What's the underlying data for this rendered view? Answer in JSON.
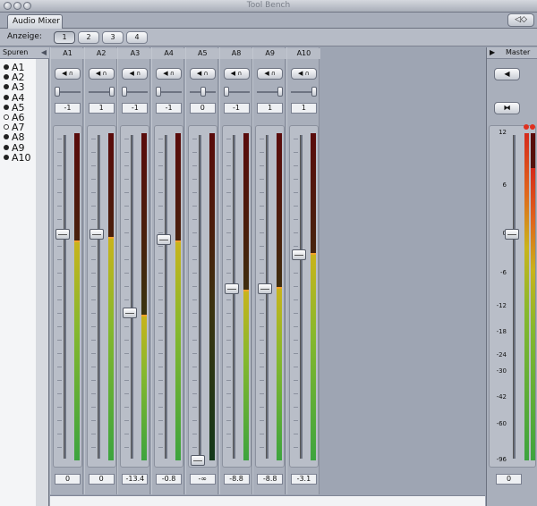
{
  "window": {
    "title": "Tool Bench"
  },
  "tab": {
    "label": "Audio Mixer",
    "icon": "speaker-icon",
    "icon_glyph": "◁◇"
  },
  "toolbar": {
    "label": "Anzeige:",
    "views": [
      "1",
      "2",
      "3",
      "4"
    ],
    "active_view": "1"
  },
  "tracks": {
    "header": "Spuren",
    "items": [
      {
        "label": "A1",
        "enabled": true
      },
      {
        "label": "A2",
        "enabled": true
      },
      {
        "label": "A3",
        "enabled": true
      },
      {
        "label": "A4",
        "enabled": true
      },
      {
        "label": "A5",
        "enabled": true
      },
      {
        "label": "A6",
        "enabled": false
      },
      {
        "label": "A7",
        "enabled": false
      },
      {
        "label": "A8",
        "enabled": true
      },
      {
        "label": "A9",
        "enabled": true
      },
      {
        "label": "A10",
        "enabled": true
      }
    ]
  },
  "channels": [
    {
      "name": "A1",
      "pan": "-1",
      "level": "0",
      "fader_db": 0,
      "meter_db": -1
    },
    {
      "name": "A2",
      "pan": "1",
      "level": "0",
      "fader_db": 0,
      "meter_db": -0.5
    },
    {
      "name": "A3",
      "pan": "-1",
      "level": "-13.4",
      "fader_db": -13.4,
      "meter_db": -14
    },
    {
      "name": "A4",
      "pan": "-1",
      "level": "-0.8",
      "fader_db": -0.8,
      "meter_db": -1
    },
    {
      "name": "A5",
      "pan": "0",
      "level": "-∞",
      "fader_db": -999,
      "meter_db": -999
    },
    {
      "name": "A8",
      "pan": "-1",
      "level": "-8.8",
      "fader_db": -8.8,
      "meter_db": -9
    },
    {
      "name": "A9",
      "pan": "1",
      "level": "-8.8",
      "fader_db": -8.8,
      "meter_db": -8.5
    },
    {
      "name": "A10",
      "pan": "1",
      "level": "-3.1",
      "fader_db": -3.1,
      "meter_db": -3
    }
  ],
  "master": {
    "label": "Master",
    "level": "0",
    "fader_db": 0,
    "meter_left_db": 12,
    "meter_right_db": 8,
    "scale": [
      "12",
      "6",
      "0",
      "-6",
      "-12",
      "-18",
      "-24",
      "-30",
      "-42",
      "-60",
      "-96"
    ]
  },
  "colors": {
    "meter_green": "#3da43e",
    "meter_yellow": "#c9b41b",
    "meter_red": "#5a0b0b",
    "peak": "#f3a22a",
    "clip": "#e0301f"
  }
}
